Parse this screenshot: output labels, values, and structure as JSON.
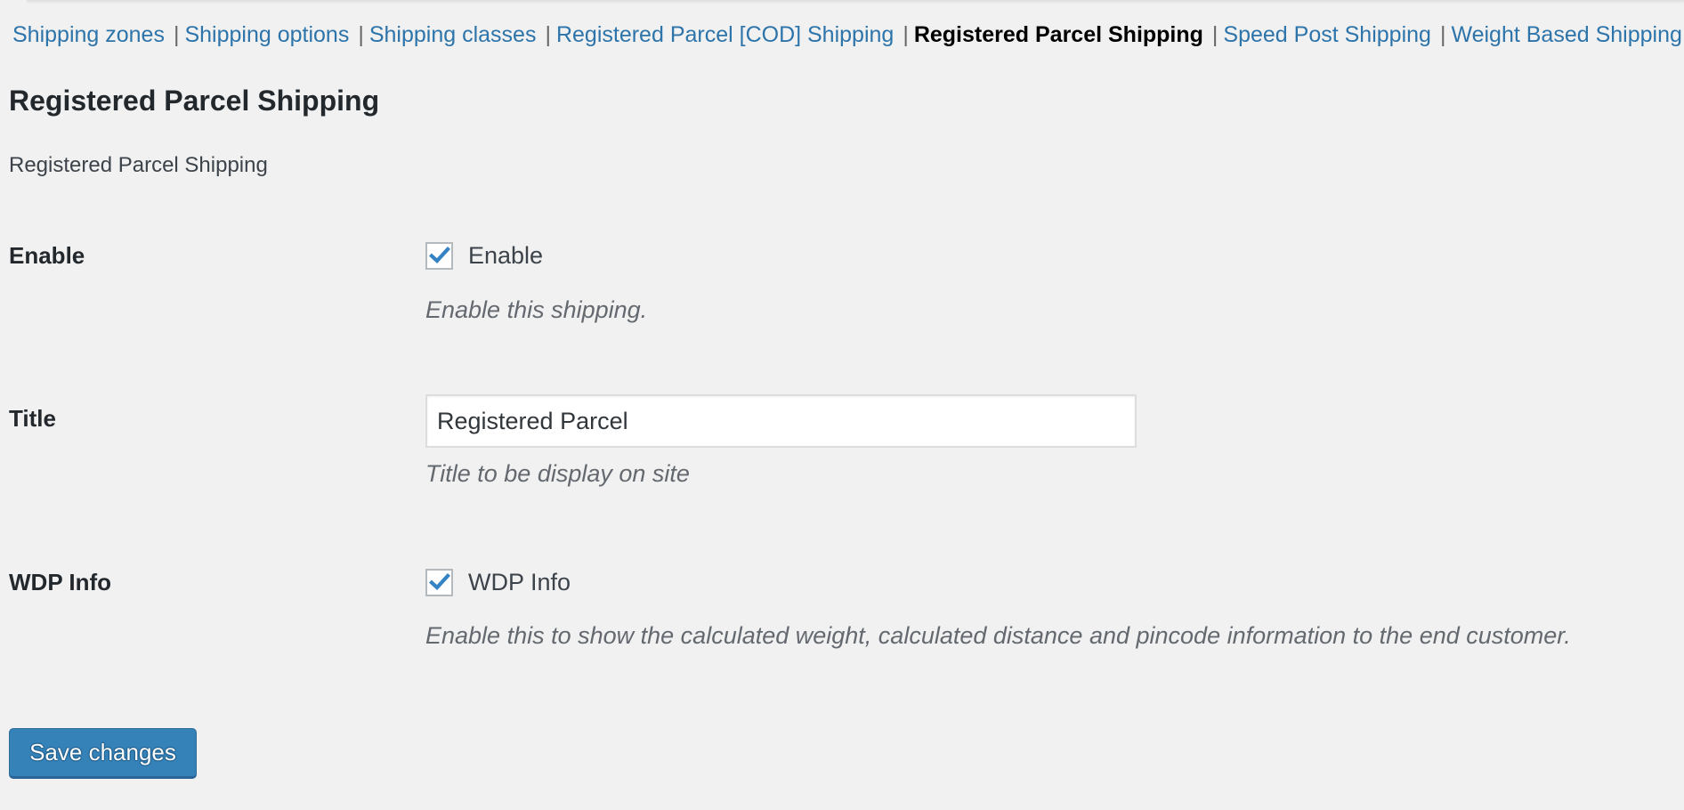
{
  "subnav": {
    "items": [
      {
        "label": "Shipping zones",
        "current": false
      },
      {
        "label": "Shipping options",
        "current": false
      },
      {
        "label": "Shipping classes",
        "current": false
      },
      {
        "label": "Registered Parcel [COD] Shipping",
        "current": false
      },
      {
        "label": "Registered Parcel Shipping",
        "current": true
      },
      {
        "label": "Speed Post Shipping",
        "current": false
      },
      {
        "label": "Weight Based Shipping",
        "current": false
      }
    ],
    "separator": "|"
  },
  "page": {
    "title": "Registered Parcel Shipping",
    "description": "Registered Parcel Shipping"
  },
  "form": {
    "enable": {
      "label": "Enable",
      "checkbox_label": "Enable",
      "checked": true,
      "help": "Enable this shipping."
    },
    "title": {
      "label": "Title",
      "value": "Registered Parcel",
      "help": "Title to be display on site"
    },
    "wdp_info": {
      "label": "WDP Info",
      "checkbox_label": "WDP Info",
      "checked": true,
      "help": "Enable this to show the calculated weight, calculated distance and pincode information to the end customer."
    }
  },
  "actions": {
    "save_label": "Save changes"
  },
  "colors": {
    "link": "#2d74aa",
    "current_link": "#000000",
    "primary_button": "#3582b8",
    "checkmark": "#3582c4",
    "background": "#f1f1f1"
  }
}
